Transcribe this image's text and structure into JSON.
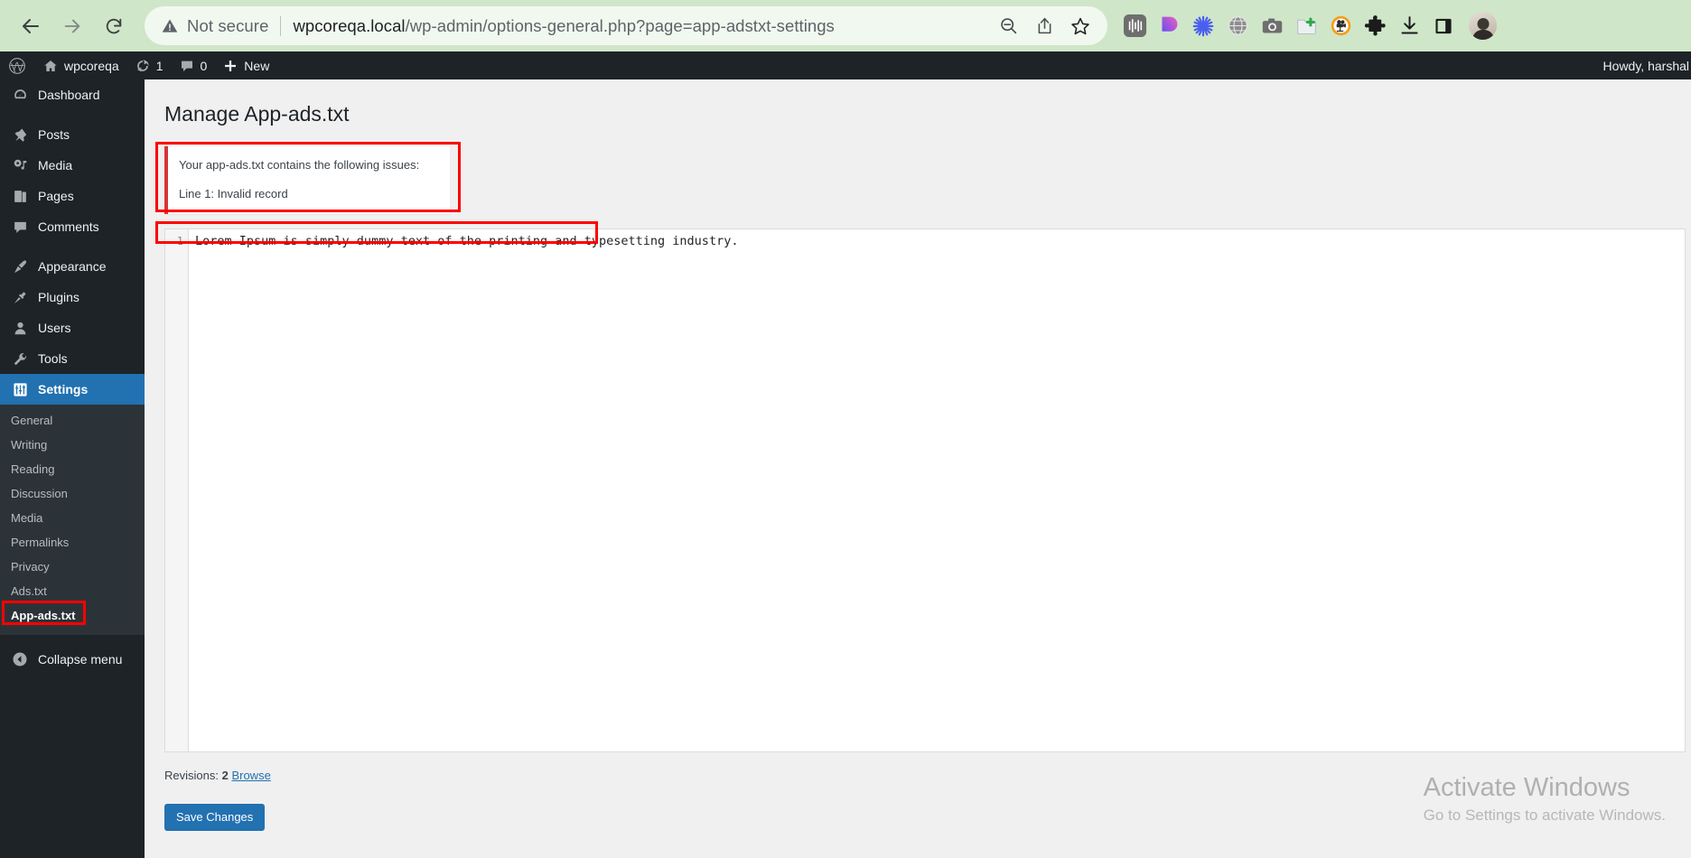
{
  "browser": {
    "back_icon": "back-arrow-icon",
    "forward_icon": "forward-arrow-icon",
    "reload_icon": "reload-icon",
    "security_label": "Not secure",
    "url_host": "wpcoreqa.local",
    "url_path": "/wp-admin/options-general.php?page=app-adstxt-settings",
    "url_full": "wpcoreqa.local/wp-admin/options-general.php?page=app-adstxt-settings",
    "omnibox_actions": [
      "zoom-out-icon",
      "share-icon",
      "bookmark-star-icon"
    ],
    "extensions": [
      "audio-waveform-icon",
      "gradient-p-icon",
      "asterisk-burst-icon",
      "globe-grid-icon",
      "camera-icon",
      "add-to-folder-icon",
      "video-recorder-icon",
      "puzzle-piece-icon",
      "download-icon",
      "side-panel-icon"
    ],
    "avatar": "user-avatar"
  },
  "adminbar": {
    "logo": "wordpress-logo-icon",
    "site_name": "wpcoreqa",
    "updates_icon": "updates-icon",
    "updates_count": "1",
    "comments_icon": "comment-bubble-icon",
    "comments_count": "0",
    "new_icon": "plus-icon",
    "new_label": "New",
    "howdy": "Howdy, harshal"
  },
  "sidebar": {
    "items": [
      {
        "label": "Dashboard",
        "icon": "dashboard-icon"
      },
      {
        "label": "Posts",
        "icon": "pin-icon"
      },
      {
        "label": "Media",
        "icon": "media-icon"
      },
      {
        "label": "Pages",
        "icon": "pages-icon"
      },
      {
        "label": "Comments",
        "icon": "comment-bubble-icon"
      },
      {
        "label": "Appearance",
        "icon": "paintbrush-icon"
      },
      {
        "label": "Plugins",
        "icon": "plug-icon"
      },
      {
        "label": "Users",
        "icon": "user-icon"
      },
      {
        "label": "Tools",
        "icon": "wrench-icon"
      },
      {
        "label": "Settings",
        "icon": "settings-sliders-icon"
      }
    ],
    "submenu": [
      "General",
      "Writing",
      "Reading",
      "Discussion",
      "Media",
      "Permalinks",
      "Privacy",
      "Ads.txt",
      "App-ads.txt"
    ],
    "current_submenu": "App-ads.txt",
    "collapse_label": "Collapse menu",
    "collapse_icon": "collapse-arrow-icon"
  },
  "main": {
    "page_title": "Manage App-ads.txt",
    "notice": {
      "heading": "Your app-ads.txt contains the following issues:",
      "line": "Line 1: Invalid record"
    },
    "editor": {
      "line_number": "1",
      "line_text": "Lorem Ipsum is simply dummy text of the printing and typesetting industry."
    },
    "revisions_label": "Revisions:",
    "revisions_count": "2",
    "revisions_browse": "Browse",
    "save_label": "Save Changes"
  },
  "watermark": {
    "title": "Activate Windows",
    "subtitle": "Go to Settings to activate Windows."
  },
  "colors": {
    "chrome_bg": "#cfe6c8",
    "wp_dark": "#1d2327",
    "wp_submenu": "#2c3338",
    "wp_blue": "#2271b1",
    "error_red": "#d63638",
    "annotation_red": "#ff0000"
  }
}
